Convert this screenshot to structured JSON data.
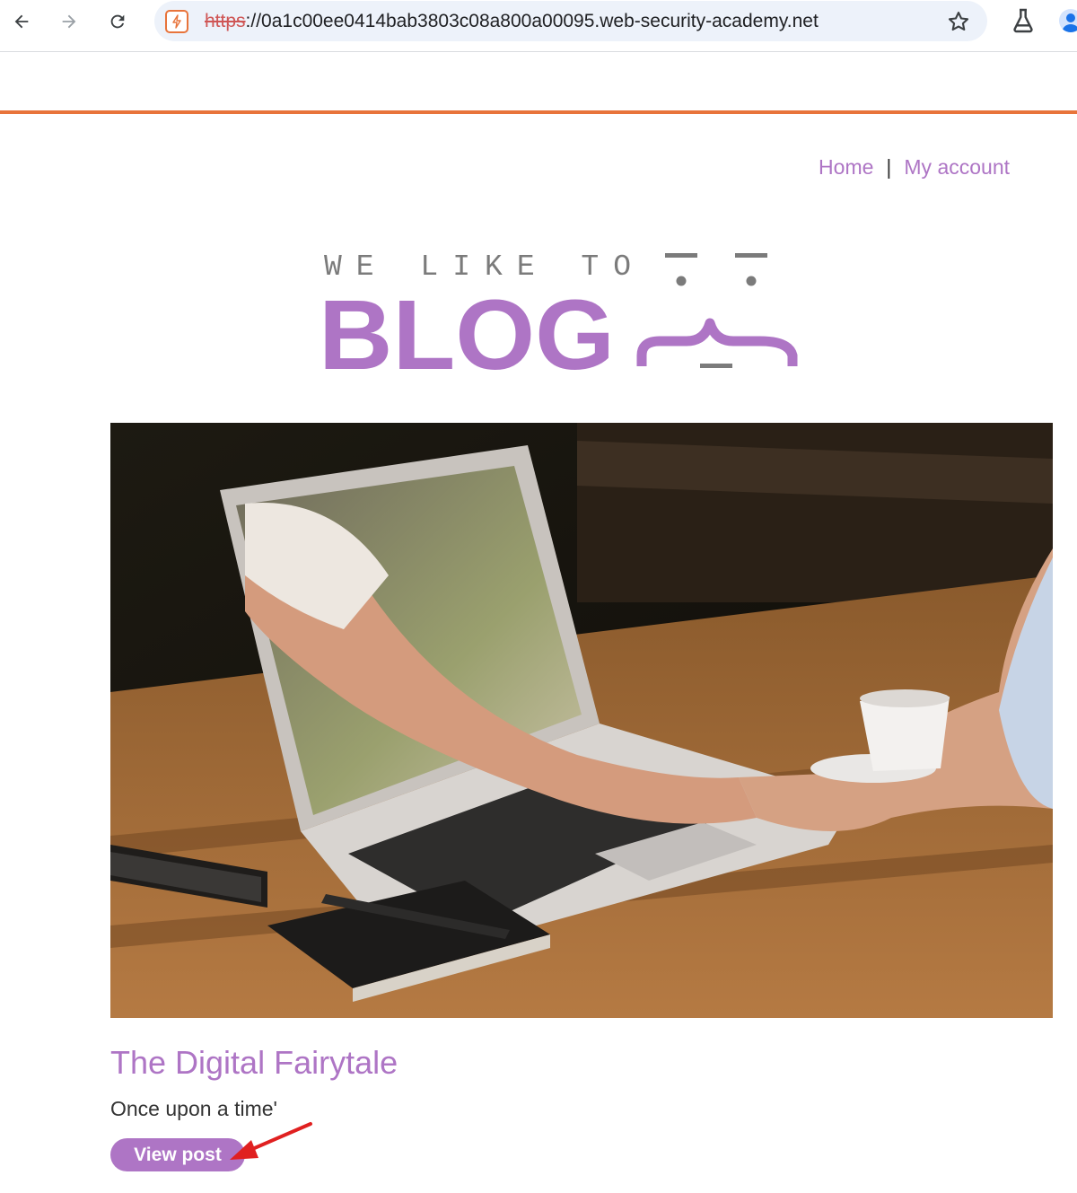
{
  "browser": {
    "url_scheme": "https",
    "url_rest": "://0a1c00ee0414bab3803c08a800a00095.web-security-academy.net",
    "icons": [
      "back-arrow-icon",
      "forward-arrow-icon",
      "reload-icon",
      "site-security-icon",
      "bookmark-star-icon",
      "labs-flask-icon",
      "profile-icon"
    ]
  },
  "header": {
    "nav": {
      "home_label": "Home",
      "separator": "|",
      "account_label": "My account"
    }
  },
  "logo": {
    "top_text": "WE LIKE TO",
    "main_text": "BLOG"
  },
  "post": {
    "image_description_icon": "handshake-laptop-image",
    "title": "The Digital Fairytale",
    "summary": "Once upon a time'",
    "button_label": "View post"
  },
  "colors": {
    "accent": "#ae75c5",
    "orange_bar": "#e8743b",
    "text": "#333333",
    "annotation_arrow": "#e02020"
  }
}
